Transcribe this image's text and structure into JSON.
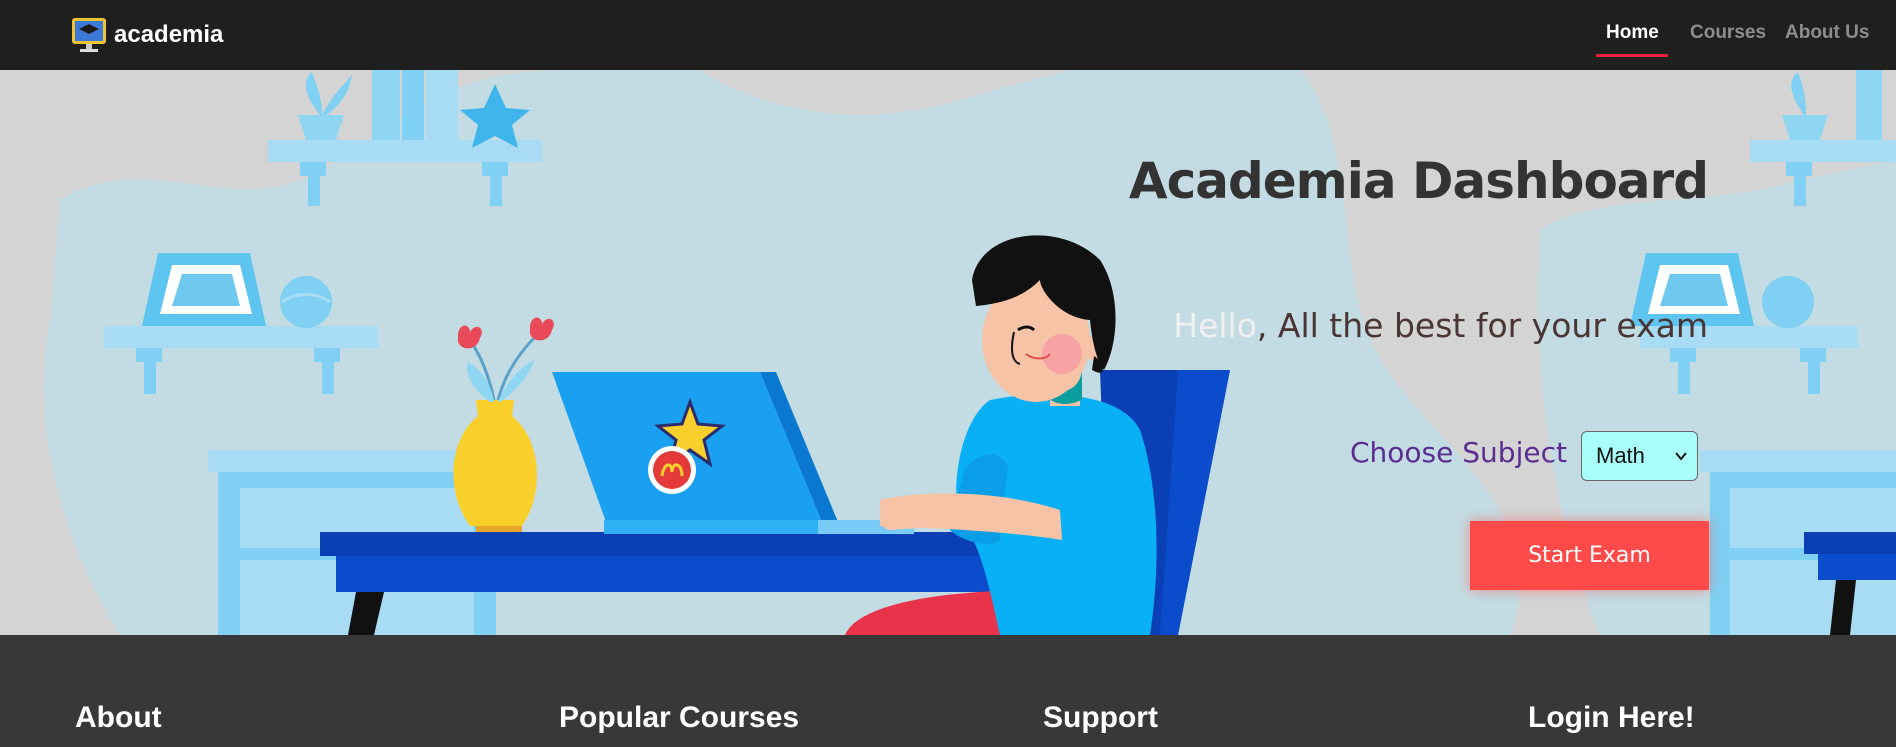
{
  "nav": {
    "brand": "academia",
    "links": [
      {
        "label": "Home",
        "active": true
      },
      {
        "label": "Courses",
        "active": false
      },
      {
        "label": "About Us",
        "active": false
      }
    ],
    "active_color": "#e8203c"
  },
  "hero": {
    "title": "Academia Dashboard",
    "greeting_hello": "Hello",
    "greeting_rest": ", All the best for your exam",
    "subject_label": "Choose Subject",
    "subject_selected": "Math",
    "start_button": "Start Exam",
    "button_color": "#fe4a49"
  },
  "footer": {
    "headings": [
      "About",
      "Popular Courses",
      "Support",
      "Login Here!"
    ]
  }
}
